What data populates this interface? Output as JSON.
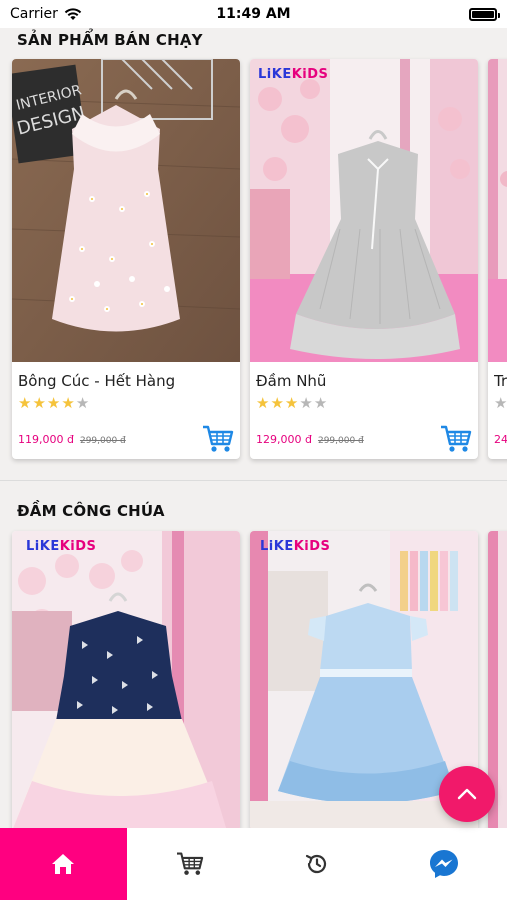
{
  "status_bar": {
    "carrier": "Carrier",
    "time": "11:49 AM",
    "battery_level": 1.0
  },
  "sections": [
    {
      "title": "SẢN PHẨM BÁN CHẠY",
      "products": [
        {
          "name": "Bông Cúc - Hết Hàng",
          "rating": 4,
          "price": "119,000 đ",
          "old_price": "299,000 đ",
          "badge": "",
          "image_desc": "white-daisy-dress"
        },
        {
          "name": "Đầm Nhũ",
          "rating": 3,
          "price": "129,000 đ",
          "old_price": "299,000 đ",
          "badge": "LiKEKiDS",
          "image_desc": "grey-glitter-dress"
        },
        {
          "name": "Tr",
          "rating": 0,
          "price": "24",
          "old_price": "",
          "badge": "",
          "image_desc": "partial"
        }
      ]
    },
    {
      "title": "ĐẦM CÔNG CHÚA",
      "products": [
        {
          "badge": "LiKEKiDS",
          "image_desc": "navy-tulle-dress"
        },
        {
          "badge": "LiKEKiDS",
          "image_desc": "blue-tulle-dress"
        },
        {
          "badge": "",
          "image_desc": "partial"
        }
      ]
    }
  ],
  "brand": {
    "like": "LiKE",
    "kids": "KiDS"
  },
  "bottom_nav": [
    {
      "name": "home",
      "icon": "home-icon",
      "active": true
    },
    {
      "name": "cart",
      "icon": "cart-icon",
      "active": false
    },
    {
      "name": "history",
      "icon": "history-icon",
      "active": false
    },
    {
      "name": "messenger",
      "icon": "messenger-icon",
      "active": false
    }
  ],
  "colors": {
    "accent": "#ff0080",
    "price": "#e6007e",
    "fab": "#f1196a",
    "cart_icon": "#1e88e5",
    "star": "#f5c33b",
    "messenger": "#1976d2"
  }
}
